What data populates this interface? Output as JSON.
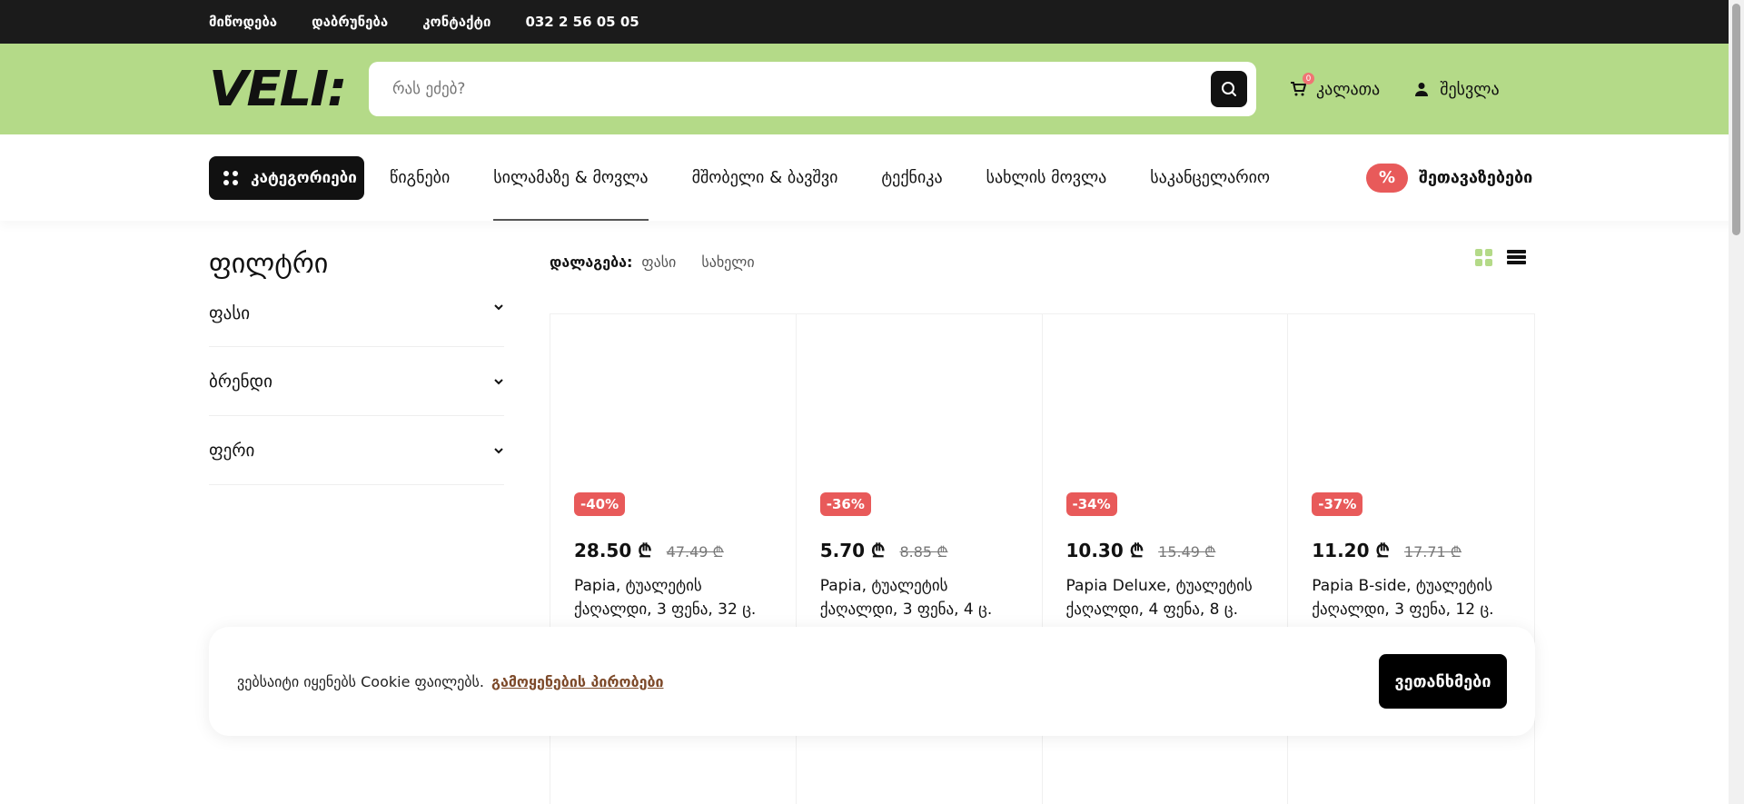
{
  "topbar": {
    "links": [
      "მიწოდება",
      "დაბრუნება",
      "კონტაქტი",
      "032 2 56 05 05"
    ]
  },
  "header": {
    "logo": "VELI:",
    "search_placeholder": "რას ეძებ?",
    "cart_label": "კალათა",
    "cart_count": "0",
    "login_label": "შესვლა"
  },
  "nav": {
    "categories_label": "კატეგორიები",
    "items": [
      "წიგნები",
      "სილამაზე & მოვლა",
      "მშობელი & ბავშვი",
      "ტექნიკა",
      "სახლის მოვლა",
      "საკანცელარიო"
    ],
    "active_index": 1,
    "offers_icon": "%",
    "offers_label": "შეთავაზებები"
  },
  "filters": {
    "title": "ფილტრი",
    "items": [
      "ფასი",
      "ბრენდი",
      "ფერი"
    ]
  },
  "sort": {
    "label": "დალაგება:",
    "options": [
      "ფასი",
      "სახელი"
    ]
  },
  "products": [
    {
      "discount": "-40%",
      "price": "28.50 ₾",
      "old_price": "47.49 ₾",
      "name": "Papia, ტუალეტის ქაღალდი, 3 ფენა, 32 ც."
    },
    {
      "discount": "-36%",
      "price": "5.70 ₾",
      "old_price": "8.85 ₾",
      "name": "Papia, ტუალეტის ქაღალდი, 3 ფენა, 4 ც."
    },
    {
      "discount": "-34%",
      "price": "10.30 ₾",
      "old_price": "15.49 ₾",
      "name": "Papia Deluxe, ტუალეტის ქაღალდი, 4 ფენა, 8 ც."
    },
    {
      "discount": "-37%",
      "price": "11.20 ₾",
      "old_price": "17.71 ₾",
      "name": "Papia B-side, ტუალეტის ქაღალდი, 3 ფენა, 12 ც."
    }
  ],
  "cookie": {
    "text": "ვებსაიტი იყენებს Cookie ფაილებს.",
    "link": "გამოყენების პირობები",
    "agree": "ვეთანხმები"
  },
  "colors": {
    "accent_green": "#b4da88",
    "sale_red": "#e85a5a",
    "dark": "#1b1b1b"
  }
}
